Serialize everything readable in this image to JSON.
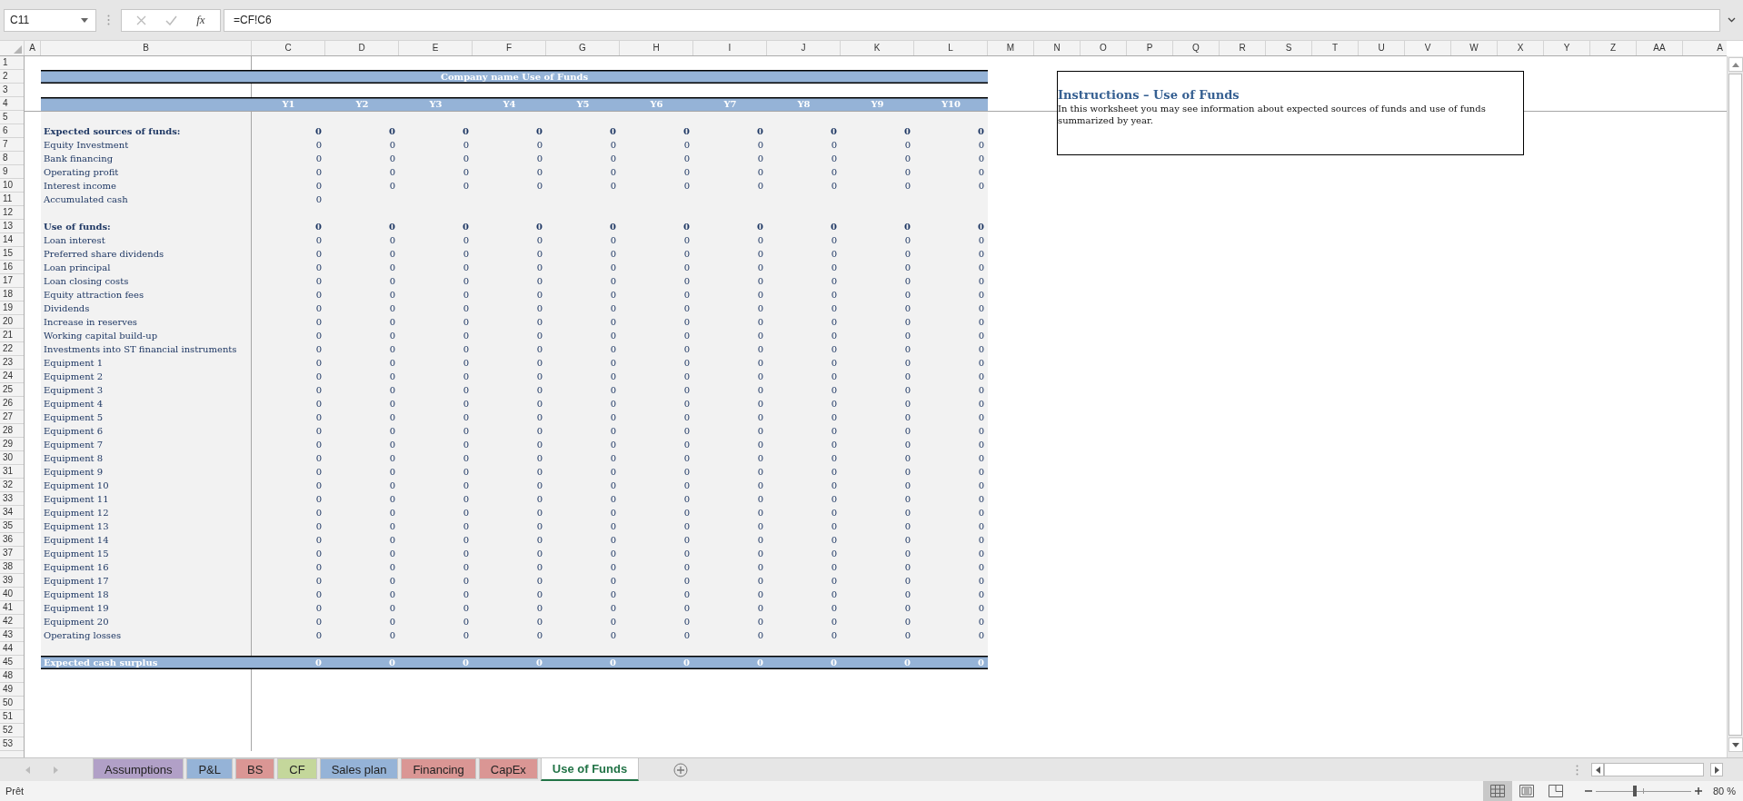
{
  "formula_bar": {
    "name_box": "C11",
    "fx_label": "fx",
    "formula": "=CF!C6"
  },
  "column_headers": [
    "A",
    "B",
    "C",
    "D",
    "E",
    "F",
    "G",
    "H",
    "I",
    "J",
    "K",
    "L",
    "M",
    "N",
    "O",
    "P",
    "Q",
    "R",
    "S",
    "T",
    "U",
    "V",
    "W",
    "X",
    "Y",
    "Z",
    "AA",
    "A"
  ],
  "sheet": {
    "title": "Company name Use of Funds",
    "years": [
      "Y1",
      "Y2",
      "Y3",
      "Y4",
      "Y5",
      "Y6",
      "Y7",
      "Y8",
      "Y9",
      "Y10"
    ],
    "rows": [
      {
        "n": "1",
        "kind": "empty"
      },
      {
        "n": "2",
        "kind": "title"
      },
      {
        "n": "3",
        "kind": "empty"
      },
      {
        "n": "4",
        "kind": "header"
      },
      {
        "n": "5",
        "kind": "blank"
      },
      {
        "n": "6",
        "kind": "section",
        "label": "Expected sources of funds:",
        "values": [
          "0",
          "0",
          "0",
          "0",
          "0",
          "0",
          "0",
          "0",
          "0",
          "0"
        ]
      },
      {
        "n": "7",
        "kind": "item",
        "label": "Equity Investment",
        "values": [
          "0",
          "0",
          "0",
          "0",
          "0",
          "0",
          "0",
          "0",
          "0",
          "0"
        ]
      },
      {
        "n": "8",
        "kind": "item",
        "label": "Bank financing",
        "values": [
          "0",
          "0",
          "0",
          "0",
          "0",
          "0",
          "0",
          "0",
          "0",
          "0"
        ]
      },
      {
        "n": "9",
        "kind": "item",
        "label": "Operating profit",
        "values": [
          "0",
          "0",
          "0",
          "0",
          "0",
          "0",
          "0",
          "0",
          "0",
          "0"
        ]
      },
      {
        "n": "10",
        "kind": "item",
        "label": "Interest income",
        "values": [
          "0",
          "0",
          "0",
          "0",
          "0",
          "0",
          "0",
          "0",
          "0",
          "0"
        ]
      },
      {
        "n": "11",
        "kind": "item",
        "label": "Accumulated cash",
        "values": [
          "0"
        ]
      },
      {
        "n": "12",
        "kind": "blank"
      },
      {
        "n": "13",
        "kind": "section",
        "label": "Use of funds:",
        "values": [
          "0",
          "0",
          "0",
          "0",
          "0",
          "0",
          "0",
          "0",
          "0",
          "0"
        ]
      },
      {
        "n": "14",
        "kind": "item",
        "label": "Loan interest",
        "values": [
          "0",
          "0",
          "0",
          "0",
          "0",
          "0",
          "0",
          "0",
          "0",
          "0"
        ]
      },
      {
        "n": "15",
        "kind": "item",
        "label": "Preferred share dividends",
        "values": [
          "0",
          "0",
          "0",
          "0",
          "0",
          "0",
          "0",
          "0",
          "0",
          "0"
        ]
      },
      {
        "n": "16",
        "kind": "item",
        "label": "Loan principal",
        "values": [
          "0",
          "0",
          "0",
          "0",
          "0",
          "0",
          "0",
          "0",
          "0",
          "0"
        ]
      },
      {
        "n": "17",
        "kind": "item",
        "label": "Loan closing costs",
        "values": [
          "0",
          "0",
          "0",
          "0",
          "0",
          "0",
          "0",
          "0",
          "0",
          "0"
        ]
      },
      {
        "n": "18",
        "kind": "item",
        "label": "Equity attraction fees",
        "values": [
          "0",
          "0",
          "0",
          "0",
          "0",
          "0",
          "0",
          "0",
          "0",
          "0"
        ]
      },
      {
        "n": "19",
        "kind": "item",
        "label": "Dividends",
        "values": [
          "0",
          "0",
          "0",
          "0",
          "0",
          "0",
          "0",
          "0",
          "0",
          "0"
        ]
      },
      {
        "n": "20",
        "kind": "item",
        "label": "Increase in reserves",
        "values": [
          "0",
          "0",
          "0",
          "0",
          "0",
          "0",
          "0",
          "0",
          "0",
          "0"
        ]
      },
      {
        "n": "21",
        "kind": "item",
        "label": "Working capital build-up",
        "values": [
          "0",
          "0",
          "0",
          "0",
          "0",
          "0",
          "0",
          "0",
          "0",
          "0"
        ]
      },
      {
        "n": "22",
        "kind": "item",
        "label": "Investments into ST financial instruments",
        "values": [
          "0",
          "0",
          "0",
          "0",
          "0",
          "0",
          "0",
          "0",
          "0",
          "0"
        ]
      },
      {
        "n": "23",
        "kind": "item",
        "label": "Equipment 1",
        "values": [
          "0",
          "0",
          "0",
          "0",
          "0",
          "0",
          "0",
          "0",
          "0",
          "0"
        ]
      },
      {
        "n": "24",
        "kind": "item",
        "label": "Equipment 2",
        "values": [
          "0",
          "0",
          "0",
          "0",
          "0",
          "0",
          "0",
          "0",
          "0",
          "0"
        ]
      },
      {
        "n": "25",
        "kind": "item",
        "label": "Equipment 3",
        "values": [
          "0",
          "0",
          "0",
          "0",
          "0",
          "0",
          "0",
          "0",
          "0",
          "0"
        ]
      },
      {
        "n": "26",
        "kind": "item",
        "label": "Equipment 4",
        "values": [
          "0",
          "0",
          "0",
          "0",
          "0",
          "0",
          "0",
          "0",
          "0",
          "0"
        ]
      },
      {
        "n": "27",
        "kind": "item",
        "label": "Equipment 5",
        "values": [
          "0",
          "0",
          "0",
          "0",
          "0",
          "0",
          "0",
          "0",
          "0",
          "0"
        ]
      },
      {
        "n": "28",
        "kind": "item",
        "label": "Equipment 6",
        "values": [
          "0",
          "0",
          "0",
          "0",
          "0",
          "0",
          "0",
          "0",
          "0",
          "0"
        ]
      },
      {
        "n": "29",
        "kind": "item",
        "label": "Equipment 7",
        "values": [
          "0",
          "0",
          "0",
          "0",
          "0",
          "0",
          "0",
          "0",
          "0",
          "0"
        ]
      },
      {
        "n": "30",
        "kind": "item",
        "label": "Equipment 8",
        "values": [
          "0",
          "0",
          "0",
          "0",
          "0",
          "0",
          "0",
          "0",
          "0",
          "0"
        ]
      },
      {
        "n": "31",
        "kind": "item",
        "label": "Equipment 9",
        "values": [
          "0",
          "0",
          "0",
          "0",
          "0",
          "0",
          "0",
          "0",
          "0",
          "0"
        ]
      },
      {
        "n": "32",
        "kind": "item",
        "label": "Equipment 10",
        "values": [
          "0",
          "0",
          "0",
          "0",
          "0",
          "0",
          "0",
          "0",
          "0",
          "0"
        ]
      },
      {
        "n": "33",
        "kind": "item",
        "label": "Equipment 11",
        "values": [
          "0",
          "0",
          "0",
          "0",
          "0",
          "0",
          "0",
          "0",
          "0",
          "0"
        ]
      },
      {
        "n": "34",
        "kind": "item",
        "label": "Equipment 12",
        "values": [
          "0",
          "0",
          "0",
          "0",
          "0",
          "0",
          "0",
          "0",
          "0",
          "0"
        ]
      },
      {
        "n": "35",
        "kind": "item",
        "label": "Equipment 13",
        "values": [
          "0",
          "0",
          "0",
          "0",
          "0",
          "0",
          "0",
          "0",
          "0",
          "0"
        ]
      },
      {
        "n": "36",
        "kind": "item",
        "label": "Equipment 14",
        "values": [
          "0",
          "0",
          "0",
          "0",
          "0",
          "0",
          "0",
          "0",
          "0",
          "0"
        ]
      },
      {
        "n": "37",
        "kind": "item",
        "label": "Equipment 15",
        "values": [
          "0",
          "0",
          "0",
          "0",
          "0",
          "0",
          "0",
          "0",
          "0",
          "0"
        ]
      },
      {
        "n": "38",
        "kind": "item",
        "label": "Equipment 16",
        "values": [
          "0",
          "0",
          "0",
          "0",
          "0",
          "0",
          "0",
          "0",
          "0",
          "0"
        ]
      },
      {
        "n": "39",
        "kind": "item",
        "label": "Equipment 17",
        "values": [
          "0",
          "0",
          "0",
          "0",
          "0",
          "0",
          "0",
          "0",
          "0",
          "0"
        ]
      },
      {
        "n": "40",
        "kind": "item",
        "label": "Equipment 18",
        "values": [
          "0",
          "0",
          "0",
          "0",
          "0",
          "0",
          "0",
          "0",
          "0",
          "0"
        ]
      },
      {
        "n": "41",
        "kind": "item",
        "label": "Equipment 19",
        "values": [
          "0",
          "0",
          "0",
          "0",
          "0",
          "0",
          "0",
          "0",
          "0",
          "0"
        ]
      },
      {
        "n": "42",
        "kind": "item",
        "label": "Equipment 20",
        "values": [
          "0",
          "0",
          "0",
          "0",
          "0",
          "0",
          "0",
          "0",
          "0",
          "0"
        ]
      },
      {
        "n": "43",
        "kind": "item",
        "label": "Operating losses",
        "values": [
          "0",
          "0",
          "0",
          "0",
          "0",
          "0",
          "0",
          "0",
          "0",
          "0"
        ]
      },
      {
        "n": "44",
        "kind": "blank"
      },
      {
        "n": "45",
        "kind": "total",
        "label": "Expected cash surplus",
        "values": [
          "0",
          "0",
          "0",
          "0",
          "0",
          "0",
          "0",
          "0",
          "0",
          "0"
        ]
      },
      {
        "n": "48",
        "kind": "empty"
      },
      {
        "n": "49",
        "kind": "empty"
      },
      {
        "n": "50",
        "kind": "empty"
      },
      {
        "n": "51",
        "kind": "empty"
      },
      {
        "n": "52",
        "kind": "empty"
      },
      {
        "n": "53",
        "kind": "empty"
      }
    ]
  },
  "instructions": {
    "title": "Instructions – Use of Funds",
    "body": "In this worksheet you may see information about expected sources of funds and use of funds summarized by year."
  },
  "tabs": [
    {
      "label": "Assumptions",
      "color": "#b1a0c7",
      "selected": false
    },
    {
      "label": "P&L",
      "color": "#95b3d7",
      "selected": false
    },
    {
      "label": "BS",
      "color": "#da9694",
      "selected": false
    },
    {
      "label": "CF",
      "color": "#c4d79b",
      "selected": false
    },
    {
      "label": "Sales plan",
      "color": "#95b3d7",
      "selected": false
    },
    {
      "label": "Financing",
      "color": "#da9694",
      "selected": false
    },
    {
      "label": "CapEx",
      "color": "#da9694",
      "selected": false
    },
    {
      "label": "Use of Funds",
      "selected": true
    }
  ],
  "status_bar": {
    "status": "Prêt",
    "views": [
      {
        "kind": "normal",
        "selected": true
      },
      {
        "kind": "page-layout",
        "selected": false
      },
      {
        "kind": "page-break",
        "selected": false
      }
    ],
    "zoom": {
      "level": 0.41,
      "label": "80 %"
    }
  }
}
